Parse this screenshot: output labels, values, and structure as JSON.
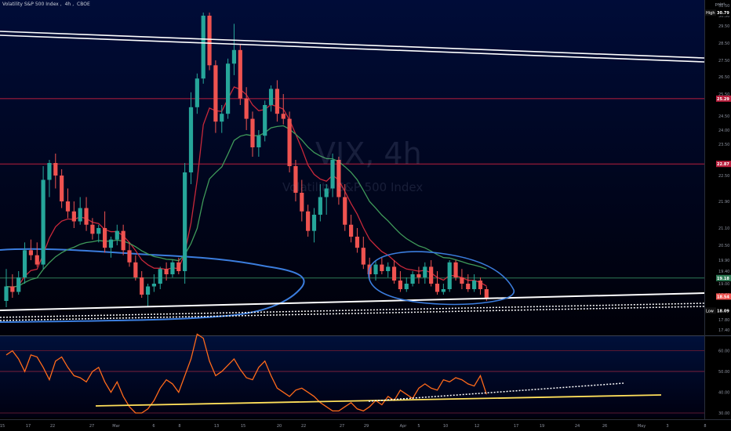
{
  "header": {
    "title": "Volatility S&P 500 Index",
    "interval": "4h",
    "exchange": "CBOE"
  },
  "watermark": {
    "symbol": "VIX, 4h",
    "name": "Volatility S&P 500 Index"
  },
  "scale_mode": "point",
  "colors": {
    "background": "#000000",
    "pane_top": "#000c38",
    "up": "#26a69a",
    "down": "#ef5350",
    "ema_fast": "#c8283a",
    "ema_slow": "#3f9a5a",
    "hline": "#b81e3c",
    "rsi_line": "#ff6a1a",
    "drawing_white": "#ffffff",
    "drawing_blue": "#3b7ddd",
    "rsi_trend": "#ffdf5a"
  },
  "chart_data": {
    "type": "candlestick",
    "title": "Volatility S&P 500 Index",
    "interval": "4h",
    "price_axis": {
      "ticks": [
        "31.50",
        "30.50",
        "29.50",
        "28.50",
        "27.50",
        "26.50",
        "25.50",
        "24.50",
        "24.00",
        "23.50",
        "22.50",
        "21.90",
        "21.10",
        "20.50",
        "19.90",
        "19.40",
        "19.00",
        "18.60",
        "17.80",
        "17.40"
      ],
      "ylim": [
        16.8,
        31.9
      ],
      "labels": [
        {
          "tag": "High",
          "value": "30.79"
        },
        {
          "value": "25.29"
        },
        {
          "value": "22.87"
        },
        {
          "value": "19.18"
        },
        {
          "value": "18.54"
        },
        {
          "tag": "Low",
          "value": "18.09"
        }
      ]
    },
    "time_axis": [
      "15",
      "17",
      "22",
      "27",
      "Mar",
      "6",
      "8",
      "13",
      "15",
      "20",
      "22",
      "27",
      "29",
      "Apr",
      "5",
      "10",
      "12",
      "17",
      "19",
      "24",
      "26",
      "May",
      "3",
      "8"
    ],
    "horizontal_lines": [
      25.29,
      22.87,
      19.18
    ],
    "candles": [
      {
        "o": 18.4,
        "h": 19.5,
        "l": 18.2,
        "c": 18.9
      },
      {
        "o": 18.9,
        "h": 19.3,
        "l": 18.5,
        "c": 18.7
      },
      {
        "o": 18.7,
        "h": 19.4,
        "l": 18.6,
        "c": 19.2
      },
      {
        "o": 19.2,
        "h": 20.6,
        "l": 19.0,
        "c": 20.3
      },
      {
        "o": 20.3,
        "h": 20.7,
        "l": 19.9,
        "c": 20.1
      },
      {
        "o": 20.1,
        "h": 20.6,
        "l": 19.6,
        "c": 19.7
      },
      {
        "o": 19.7,
        "h": 22.8,
        "l": 19.5,
        "c": 22.4
      },
      {
        "o": 22.4,
        "h": 23.0,
        "l": 22.0,
        "c": 22.9
      },
      {
        "o": 22.9,
        "h": 23.2,
        "l": 22.2,
        "c": 22.5
      },
      {
        "o": 22.5,
        "h": 22.7,
        "l": 21.7,
        "c": 21.9
      },
      {
        "o": 21.9,
        "h": 22.2,
        "l": 21.4,
        "c": 21.6
      },
      {
        "o": 21.6,
        "h": 21.9,
        "l": 21.1,
        "c": 21.3
      },
      {
        "o": 21.3,
        "h": 22.0,
        "l": 21.2,
        "c": 21.7
      },
      {
        "o": 21.7,
        "h": 22.0,
        "l": 21.0,
        "c": 21.2
      },
      {
        "o": 21.2,
        "h": 21.4,
        "l": 20.7,
        "c": 20.9
      },
      {
        "o": 20.9,
        "h": 21.2,
        "l": 20.6,
        "c": 21.1
      },
      {
        "o": 21.1,
        "h": 21.6,
        "l": 20.2,
        "c": 20.4
      },
      {
        "o": 20.4,
        "h": 20.8,
        "l": 20.0,
        "c": 20.7
      },
      {
        "o": 20.7,
        "h": 21.2,
        "l": 20.5,
        "c": 21.0
      },
      {
        "o": 21.0,
        "h": 21.2,
        "l": 20.1,
        "c": 20.3
      },
      {
        "o": 20.3,
        "h": 20.6,
        "l": 19.6,
        "c": 19.8
      },
      {
        "o": 19.8,
        "h": 20.1,
        "l": 19.1,
        "c": 19.2
      },
      {
        "o": 19.2,
        "h": 19.4,
        "l": 18.5,
        "c": 18.6
      },
      {
        "o": 18.6,
        "h": 19.0,
        "l": 18.2,
        "c": 18.9
      },
      {
        "o": 18.9,
        "h": 19.3,
        "l": 18.7,
        "c": 19.0
      },
      {
        "o": 19.0,
        "h": 19.6,
        "l": 18.8,
        "c": 19.5
      },
      {
        "o": 19.5,
        "h": 19.8,
        "l": 19.1,
        "c": 19.3
      },
      {
        "o": 19.3,
        "h": 19.9,
        "l": 19.2,
        "c": 19.8
      },
      {
        "o": 19.8,
        "h": 20.0,
        "l": 19.3,
        "c": 19.4
      },
      {
        "o": 19.4,
        "h": 22.9,
        "l": 19.0,
        "c": 22.6
      },
      {
        "o": 22.6,
        "h": 25.6,
        "l": 22.3,
        "c": 24.9
      },
      {
        "o": 24.9,
        "h": 26.7,
        "l": 24.6,
        "c": 26.4
      },
      {
        "o": 26.4,
        "h": 30.8,
        "l": 26.1,
        "c": 30.5
      },
      {
        "o": 30.5,
        "h": 30.8,
        "l": 26.9,
        "c": 27.2
      },
      {
        "o": 27.2,
        "h": 27.5,
        "l": 23.9,
        "c": 24.3
      },
      {
        "o": 24.3,
        "h": 25.0,
        "l": 23.9,
        "c": 24.6
      },
      {
        "o": 24.6,
        "h": 27.6,
        "l": 24.4,
        "c": 27.3
      },
      {
        "o": 27.3,
        "h": 29.7,
        "l": 26.6,
        "c": 28.1
      },
      {
        "o": 28.1,
        "h": 28.4,
        "l": 25.0,
        "c": 25.3
      },
      {
        "o": 25.3,
        "h": 25.9,
        "l": 24.0,
        "c": 24.4
      },
      {
        "o": 24.4,
        "h": 24.7,
        "l": 23.1,
        "c": 23.4
      },
      {
        "o": 23.4,
        "h": 24.0,
        "l": 23.1,
        "c": 23.8
      },
      {
        "o": 23.8,
        "h": 25.2,
        "l": 23.6,
        "c": 25.0
      },
      {
        "o": 25.0,
        "h": 26.0,
        "l": 24.7,
        "c": 25.8
      },
      {
        "o": 25.8,
        "h": 26.3,
        "l": 24.3,
        "c": 24.6
      },
      {
        "o": 24.6,
        "h": 25.5,
        "l": 24.2,
        "c": 24.4
      },
      {
        "o": 24.4,
        "h": 24.7,
        "l": 22.6,
        "c": 22.8
      },
      {
        "o": 22.8,
        "h": 23.0,
        "l": 21.9,
        "c": 22.1
      },
      {
        "o": 22.1,
        "h": 22.4,
        "l": 21.3,
        "c": 21.6
      },
      {
        "o": 21.6,
        "h": 21.8,
        "l": 20.8,
        "c": 21.0
      },
      {
        "o": 21.0,
        "h": 21.7,
        "l": 20.6,
        "c": 21.5
      },
      {
        "o": 21.5,
        "h": 22.3,
        "l": 21.3,
        "c": 22.0
      },
      {
        "o": 22.0,
        "h": 22.3,
        "l": 21.5,
        "c": 22.2
      },
      {
        "o": 22.2,
        "h": 23.2,
        "l": 22.0,
        "c": 23.0
      },
      {
        "o": 23.0,
        "h": 23.1,
        "l": 21.8,
        "c": 22.0
      },
      {
        "o": 22.0,
        "h": 22.3,
        "l": 21.0,
        "c": 21.2
      },
      {
        "o": 21.2,
        "h": 21.5,
        "l": 20.6,
        "c": 20.8
      },
      {
        "o": 20.8,
        "h": 21.1,
        "l": 20.2,
        "c": 20.4
      },
      {
        "o": 20.4,
        "h": 20.8,
        "l": 19.5,
        "c": 19.7
      },
      {
        "o": 19.7,
        "h": 20.0,
        "l": 19.1,
        "c": 19.3
      },
      {
        "o": 19.3,
        "h": 19.9,
        "l": 19.1,
        "c": 19.7
      },
      {
        "o": 19.7,
        "h": 20.0,
        "l": 19.3,
        "c": 19.4
      },
      {
        "o": 19.4,
        "h": 19.8,
        "l": 19.2,
        "c": 19.6
      },
      {
        "o": 19.6,
        "h": 19.9,
        "l": 19.0,
        "c": 19.1
      },
      {
        "o": 19.1,
        "h": 19.4,
        "l": 18.7,
        "c": 18.8
      },
      {
        "o": 18.8,
        "h": 19.2,
        "l": 18.7,
        "c": 19.0
      },
      {
        "o": 19.0,
        "h": 19.4,
        "l": 18.9,
        "c": 19.3
      },
      {
        "o": 19.3,
        "h": 19.6,
        "l": 19.0,
        "c": 19.2
      },
      {
        "o": 19.2,
        "h": 19.8,
        "l": 19.0,
        "c": 19.6
      },
      {
        "o": 19.6,
        "h": 19.9,
        "l": 18.9,
        "c": 19.0
      },
      {
        "o": 19.0,
        "h": 19.4,
        "l": 18.6,
        "c": 18.7
      },
      {
        "o": 18.7,
        "h": 19.0,
        "l": 18.6,
        "c": 18.8
      },
      {
        "o": 18.8,
        "h": 19.9,
        "l": 18.7,
        "c": 19.8
      },
      {
        "o": 19.8,
        "h": 19.9,
        "l": 19.1,
        "c": 19.2
      },
      {
        "o": 19.2,
        "h": 19.5,
        "l": 18.8,
        "c": 19.0
      },
      {
        "o": 19.0,
        "h": 19.3,
        "l": 18.7,
        "c": 18.8
      },
      {
        "o": 18.8,
        "h": 19.3,
        "l": 18.7,
        "c": 19.1
      },
      {
        "o": 19.1,
        "h": 19.2,
        "l": 18.6,
        "c": 18.8
      },
      {
        "o": 18.8,
        "h": 18.9,
        "l": 18.4,
        "c": 18.5
      }
    ],
    "rsi": {
      "ticks": [
        "60.00",
        "50.00",
        "40.00",
        "30.00"
      ],
      "ylim": [
        27,
        67
      ],
      "values": [
        58,
        60,
        56,
        50,
        58,
        57,
        52,
        46,
        55,
        57,
        52,
        48,
        47,
        45,
        50,
        52,
        45,
        40,
        45,
        38,
        33,
        30,
        30,
        32,
        36,
        42,
        46,
        44,
        40,
        48,
        56,
        68,
        66,
        55,
        48,
        50,
        53,
        56,
        51,
        47,
        46,
        52,
        55,
        48,
        42,
        40,
        38,
        41,
        42,
        40,
        38,
        35,
        33,
        31,
        31,
        33,
        35,
        32,
        31,
        33,
        36,
        34,
        38,
        36,
        41,
        39,
        37,
        42,
        44,
        42,
        41,
        46,
        45,
        47,
        46,
        44,
        43,
        48,
        39
      ]
    }
  }
}
